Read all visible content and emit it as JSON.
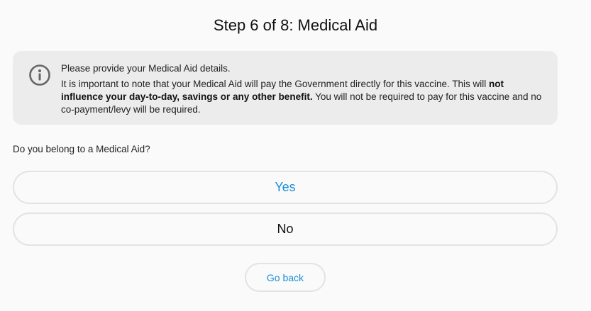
{
  "header": {
    "title": "Step 6 of 8: Medical Aid"
  },
  "info": {
    "icon": "info-circle-icon",
    "line1": "Please provide your Medical Aid details.",
    "line2_prefix": "It is important to note that your Medical Aid will pay the Government directly for this vaccine.  This will ",
    "line2_bold": "not influence your day-to-day, savings or any other benefit.",
    "line2_suffix": " You will not be required to pay for this vaccine and no co-payment/levy will be required."
  },
  "question": {
    "label": "Do you belong to a Medical Aid?"
  },
  "options": {
    "yes_label": "Yes",
    "no_label": "No"
  },
  "footer": {
    "back_label": "Go back"
  },
  "colors": {
    "accent": "#1a8fd6",
    "info_background": "#ececec",
    "border": "#e3e3e3"
  }
}
